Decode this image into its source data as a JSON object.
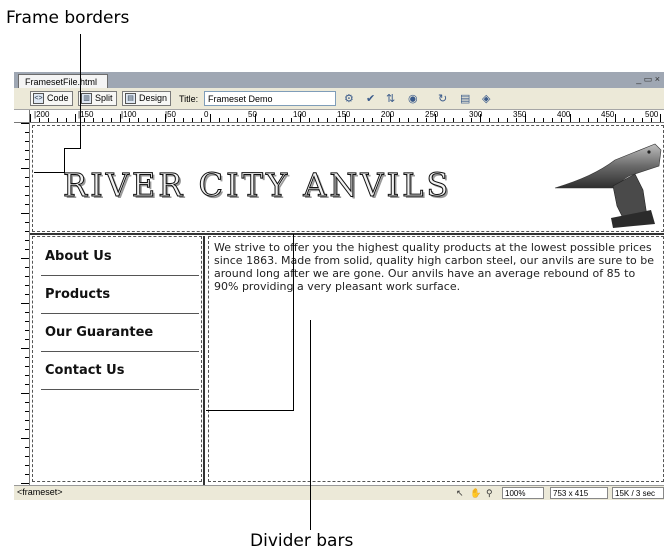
{
  "annotations": {
    "frame_borders": "Frame borders",
    "divider_bars": "Divider bars"
  },
  "window": {
    "file_tab": "FramesetFile.html",
    "controls": "_ ▭ ×"
  },
  "toolbar": {
    "code_label": "Code",
    "split_label": "Split",
    "design_label": "Design",
    "title_label": "Title:",
    "title_value": "Frameset Demo"
  },
  "ruler": {
    "labels": [
      "|200",
      "|150",
      "|100",
      "|50",
      "0",
      "50",
      "100",
      "150",
      "200",
      "250",
      "300",
      "350",
      "400",
      "450",
      "500"
    ]
  },
  "page": {
    "site_title": "RIVER CITY ANVILS",
    "nav": [
      "About Us",
      "Products",
      "Our Guarantee",
      "Contact Us"
    ],
    "body_text": "We strive to offer you the highest quality products at the lowest possible prices since 1863. Made from solid, quality high carbon steel, our anvils are sure to be around long after we are gone. Our anvils have an average rebound of 85 to 90% providing a very pleasant work surface."
  },
  "status": {
    "tag": "<frameset>",
    "zoom": "100%",
    "size": "753 x 415",
    "download": "15K / 3 sec"
  },
  "icons": [
    "code-icon",
    "split-icon",
    "design-icon",
    "validate-icon",
    "debug-icon",
    "file-mgmt-icon",
    "preview-icon",
    "refresh-icon",
    "view-options-icon",
    "visual-aids-icon",
    "pointer-icon",
    "hand-icon",
    "zoom-icon",
    "anvil-image"
  ]
}
